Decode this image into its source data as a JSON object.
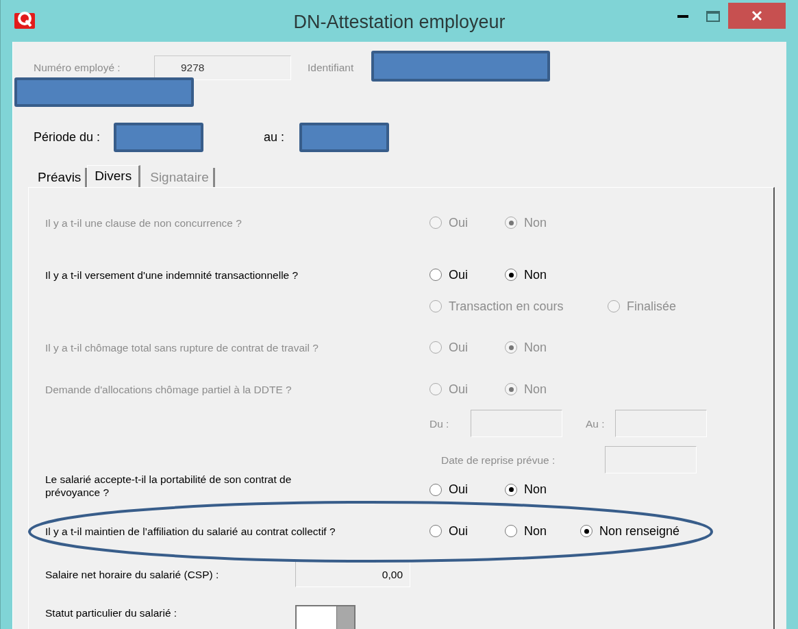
{
  "window": {
    "title": "DN-Attestation employeur"
  },
  "header": {
    "employee_label": "Numéro employé :",
    "employee_number": "9278",
    "identifier_label": "Identifiant",
    "period_from_label": "Période du :",
    "period_to_label": "au :"
  },
  "tabs": [
    {
      "label": "Préavis",
      "selected": false,
      "disabled": false
    },
    {
      "label": "Divers",
      "selected": true,
      "disabled": false
    },
    {
      "label": "Signataire",
      "selected": false,
      "disabled": true
    }
  ],
  "rows": [
    {
      "kind": "question",
      "label": "Il y a t-il une clause de non concurrence ?",
      "disabled": true,
      "options": [
        {
          "label": "Oui",
          "selected": false
        },
        {
          "label": "Non",
          "selected": true
        }
      ]
    },
    {
      "kind": "question",
      "label": "Il y a t-il versement d'une indemnité transactionnelle ?",
      "disabled": false,
      "options": [
        {
          "label": "Oui",
          "selected": false
        },
        {
          "label": "Non",
          "selected": true
        }
      ]
    },
    {
      "kind": "suboptions",
      "disabled": true,
      "options": [
        {
          "label": "Transaction en cours",
          "selected": false
        },
        {
          "label": "Finalisée",
          "selected": false
        }
      ]
    },
    {
      "kind": "question",
      "label": "Il y a t-il chômage total sans rupture de contrat de travail ?",
      "disabled": true,
      "options": [
        {
          "label": "Oui",
          "selected": false
        },
        {
          "label": "Non",
          "selected": true
        }
      ]
    },
    {
      "kind": "question",
      "label": "Demande d'allocations chômage partiel à la DDTE ?",
      "disabled": true,
      "options": [
        {
          "label": "Oui",
          "selected": false
        },
        {
          "label": "Non",
          "selected": true
        }
      ]
    },
    {
      "kind": "daterange",
      "from_label": "Du :",
      "to_label": "Au :"
    },
    {
      "kind": "datefield",
      "label": "Date de reprise prévue :"
    },
    {
      "kind": "question",
      "label": "Le salarié accepte-t-il la portabilité de son contrat de prévoyance ?",
      "disabled": false,
      "options": [
        {
          "label": "Oui",
          "selected": false
        },
        {
          "label": "Non",
          "selected": true
        }
      ]
    },
    {
      "kind": "question",
      "label": "Il y a t-il maintien de l’affiliation du salarié au contrat collectif ?",
      "disabled": false,
      "options": [
        {
          "label": "Oui",
          "selected": false
        },
        {
          "label": "Non",
          "selected": false
        },
        {
          "label": "Non renseigné",
          "selected": true
        }
      ]
    },
    {
      "kind": "amount",
      "label": "Salaire net horaire du salarié (CSP) :",
      "value": "0,00"
    },
    {
      "kind": "dropdown",
      "label": "Statut particulier du salarié :"
    }
  ]
}
